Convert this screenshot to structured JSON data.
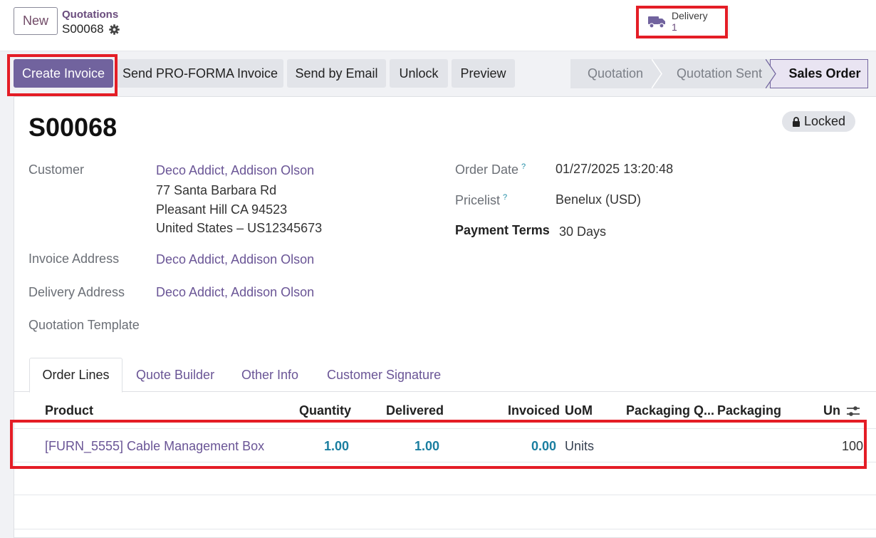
{
  "control_panel": {
    "new_label": "New",
    "breadcrumb_parent": "Quotations",
    "breadcrumb_current": "S00068",
    "delivery": {
      "label": "Delivery",
      "count": "1"
    }
  },
  "actions": {
    "create_invoice": "Create Invoice",
    "send_proforma": "Send PRO-FORMA Invoice",
    "send_email": "Send by Email",
    "unlock": "Unlock",
    "preview": "Preview"
  },
  "statusbar": {
    "stages": [
      "Quotation",
      "Quotation Sent",
      "Sales Order"
    ],
    "current": "Sales Order"
  },
  "form": {
    "name": "S00068",
    "locked_label": "Locked",
    "customer_label": "Customer",
    "customer_name": "Deco Addict, Addison Olson",
    "address_line1": "77 Santa Barbara Rd",
    "address_line2": "Pleasant Hill CA 94523",
    "address_line3": "United States – US12345673",
    "invoice_address_label": "Invoice Address",
    "invoice_address": "Deco Addict, Addison Olson",
    "delivery_address_label": "Delivery Address",
    "delivery_address": "Deco Addict, Addison Olson",
    "quotation_template_label": "Quotation Template",
    "order_date_label": "Order Date",
    "order_date": "01/27/2025 13:20:48",
    "pricelist_label": "Pricelist",
    "pricelist": "Benelux (USD)",
    "payment_terms_label": "Payment Terms",
    "payment_terms": "30 Days",
    "help_mark": "?"
  },
  "tabs": [
    "Order Lines",
    "Quote Builder",
    "Other Info",
    "Customer Signature"
  ],
  "order_lines": {
    "headers": {
      "product": "Product",
      "quantity": "Quantity",
      "delivered": "Delivered",
      "invoiced": "Invoiced",
      "uom": "UoM",
      "packaging_qty": "Packaging Q...",
      "packaging": "Packaging",
      "unit_price": "Un"
    },
    "rows": [
      {
        "product": "[FURN_5555] Cable Management Box",
        "quantity": "1.00",
        "delivered": "1.00",
        "invoiced": "0.00",
        "uom": "Units",
        "unit_price": "100.0"
      }
    ]
  },
  "colors": {
    "primary": "#71639e",
    "link": "#6a5596",
    "numeric": "#1a7ea0",
    "highlight": "#e41d26"
  }
}
